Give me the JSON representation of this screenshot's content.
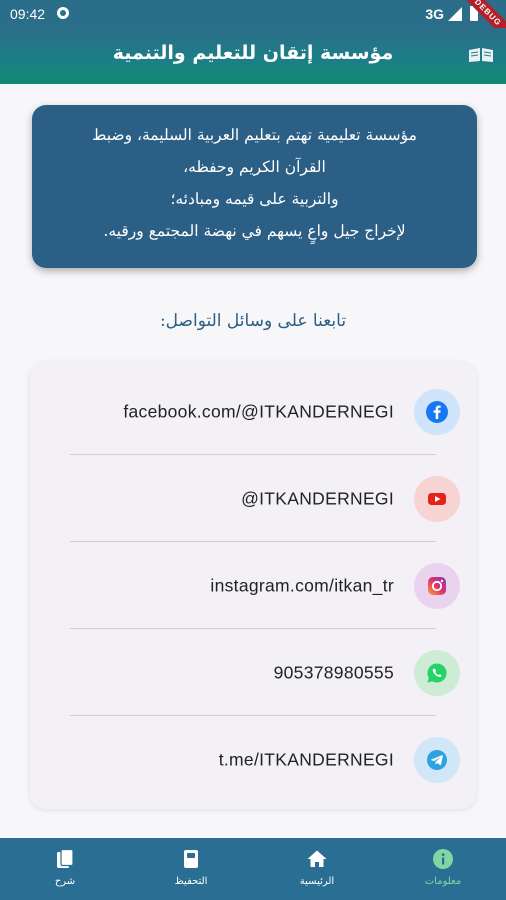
{
  "status_bar": {
    "time": "09:42",
    "network": "3G",
    "debug_label": "DEBUG"
  },
  "app_bar": {
    "title": "مؤسسة إتقان للتعليم والتنمية",
    "logo_icon": "book-logo-icon"
  },
  "intro": {
    "lines": [
      "مؤسسة تعليمية تهتم بتعليم العربية السليمة، وضبط",
      "القرآن الكريم وحفظه،",
      "والتربية على قيمه ومبادئه؛",
      "لإخراج جيل واعٍ يسهم في نهضة المجتمع ورقيه."
    ],
    "card_color": "#2c5f85"
  },
  "follow_heading": "تابعنا على وسائل التواصل:",
  "contacts": [
    {
      "text": "facebook.com/@ITKANDERNEGI",
      "icon": "facebook-icon",
      "color": "#1877f2",
      "bg": "#cfe3fb"
    },
    {
      "text": "@ITKANDERNEGI",
      "icon": "youtube-icon",
      "color": "#e62117",
      "bg": "#f8d3d3"
    },
    {
      "text": "instagram.com/itkan_tr",
      "icon": "instagram-icon",
      "color": "#c13584",
      "bg": "#ead3ee"
    },
    {
      "text": "905378980555",
      "icon": "whatsapp-icon",
      "color": "#25d366",
      "bg": "#cdebd5"
    },
    {
      "text": "t.me/ITKANDERNEGI",
      "icon": "telegram-icon",
      "color": "#2aa3df",
      "bg": "#cfe7f7"
    }
  ],
  "bottom_nav": {
    "items": [
      {
        "label": "معلومات",
        "icon": "info-icon",
        "active": true
      },
      {
        "label": "الرئيسية",
        "icon": "home-icon",
        "active": false
      },
      {
        "label": "التحفيظ",
        "icon": "book-icon",
        "active": false
      },
      {
        "label": "شرح",
        "icon": "books-icon",
        "active": false
      }
    ],
    "active_color": "#7fd6a5",
    "bar_color": "#2a6e93"
  }
}
